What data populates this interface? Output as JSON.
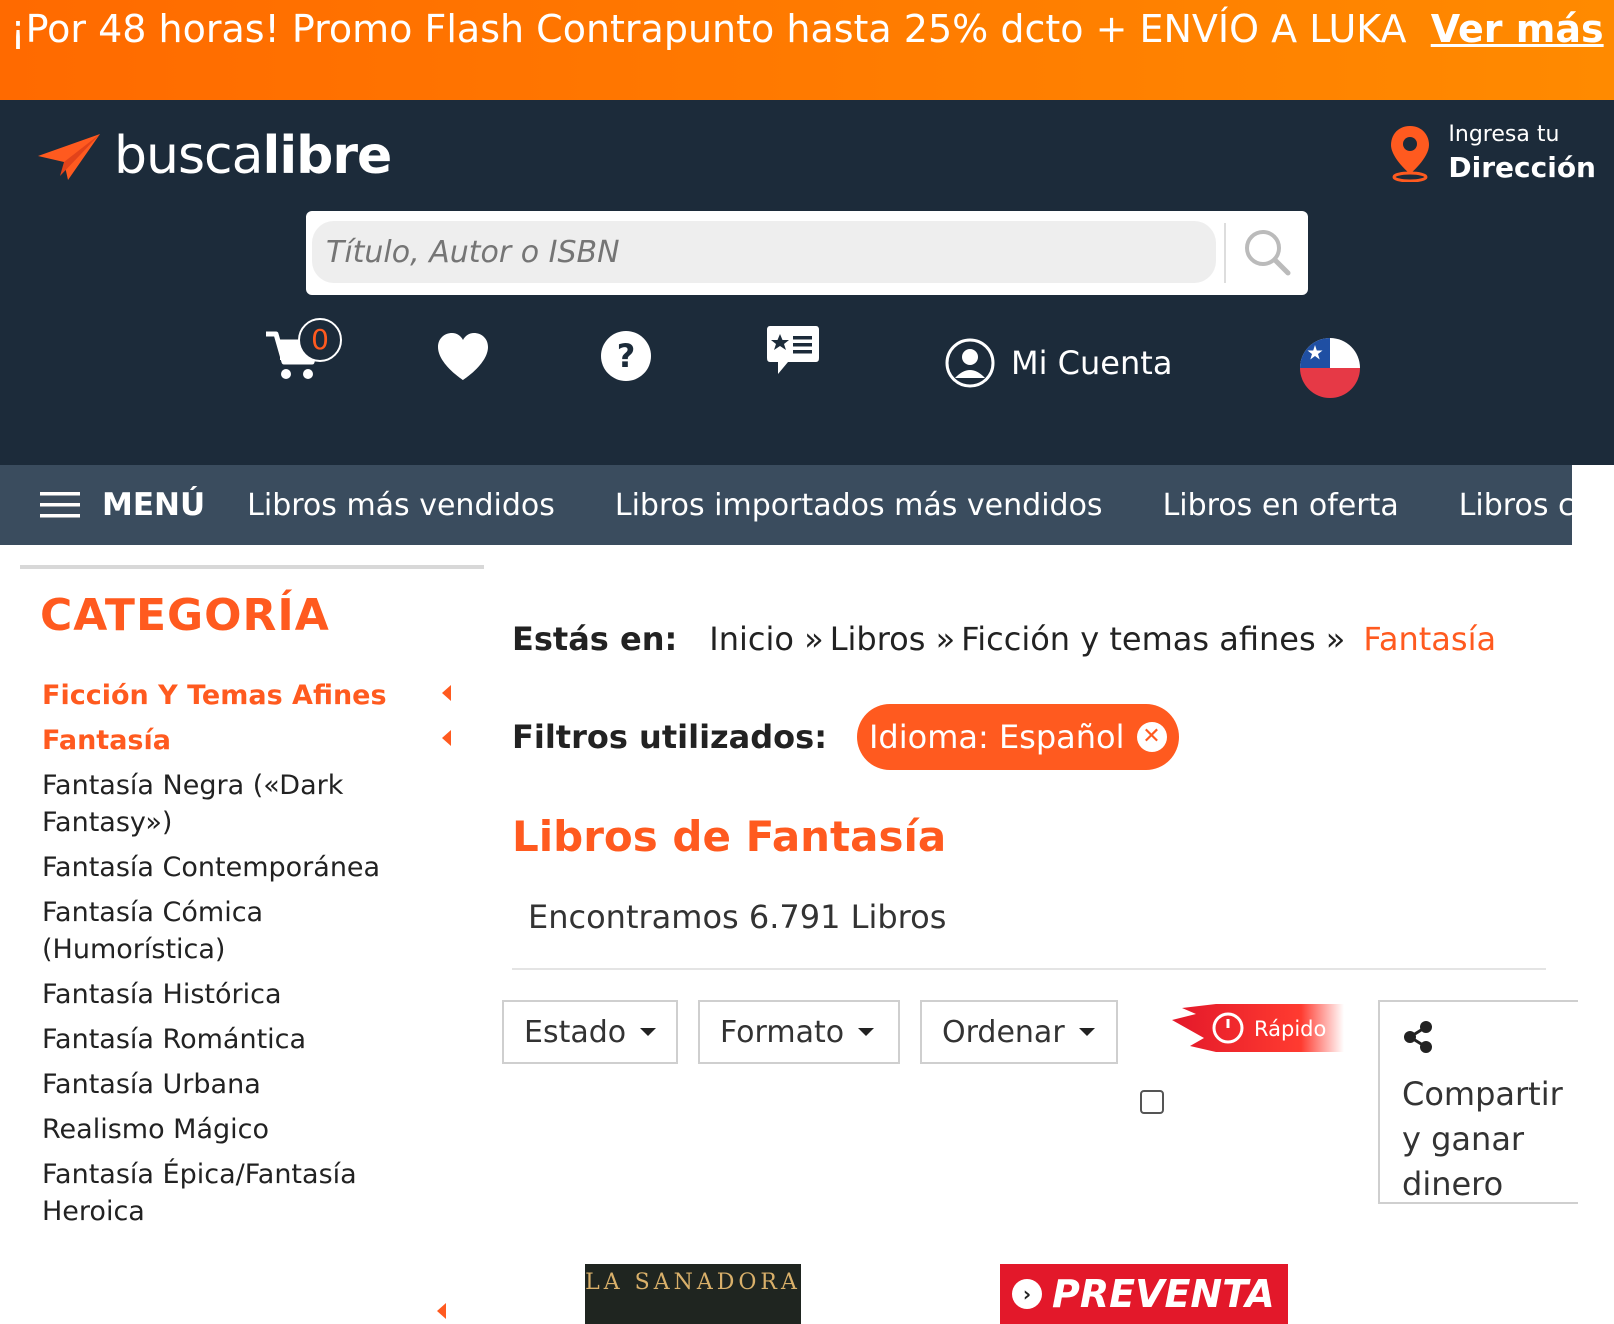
{
  "promo": {
    "text": "¡Por 48 horas! Promo Flash Contrapunto hasta 25% dcto + ENVÍO A LUKA",
    "link": "Ver más"
  },
  "header": {
    "logo": {
      "part1": "busca",
      "part2": "libre"
    },
    "address": {
      "line1": "Ingresa tu",
      "line2": "Dirección"
    },
    "search_placeholder": "Título, Autor o ISBN",
    "cart_count": "0",
    "account_label": "Mi Cuenta",
    "colors": {
      "bg": "#1c2b3a",
      "accent": "#ff5a1f"
    }
  },
  "nav": {
    "menu_label": "MENÚ",
    "items": [
      "Libros más vendidos",
      "Libros importados más vendidos",
      "Libros en oferta",
      "Libros con e"
    ]
  },
  "sidebar": {
    "title": "CATEGORÍA",
    "items": [
      {
        "label": "Ficción Y Temas Afines",
        "active": true
      },
      {
        "label": "Fantasía",
        "active": true
      },
      {
        "label": "Fantasía Negra («Dark Fantasy»)",
        "active": false
      },
      {
        "label": "Fantasía Contemporánea",
        "active": false
      },
      {
        "label": "Fantasía Cómica (Humorística)",
        "active": false
      },
      {
        "label": "Fantasía Histórica",
        "active": false
      },
      {
        "label": "Fantasía Romántica",
        "active": false
      },
      {
        "label": "Fantasía Urbana",
        "active": false
      },
      {
        "label": "Realismo Mágico",
        "active": false
      },
      {
        "label": "Fantasía Épica/Fantasía Heroica",
        "active": false
      }
    ]
  },
  "breadcrumb": {
    "label": "Estás en:",
    "items": [
      "Inicio »",
      "Libros »",
      "Ficción y temas afines »"
    ],
    "current": "Fantasía"
  },
  "filters": {
    "label": "Filtros utilizados:",
    "chip": "Idioma: Español"
  },
  "main": {
    "title": "Libros de Fantasía",
    "count_text": "Encontramos 6.791 Libros",
    "selects": [
      "Estado",
      "Formato",
      "Ordenar"
    ],
    "fast_label": "Rápido",
    "share_label": "Compartir y ganar dinero",
    "book_title": "LA SANADORA",
    "preventa": "PREVENTA"
  }
}
